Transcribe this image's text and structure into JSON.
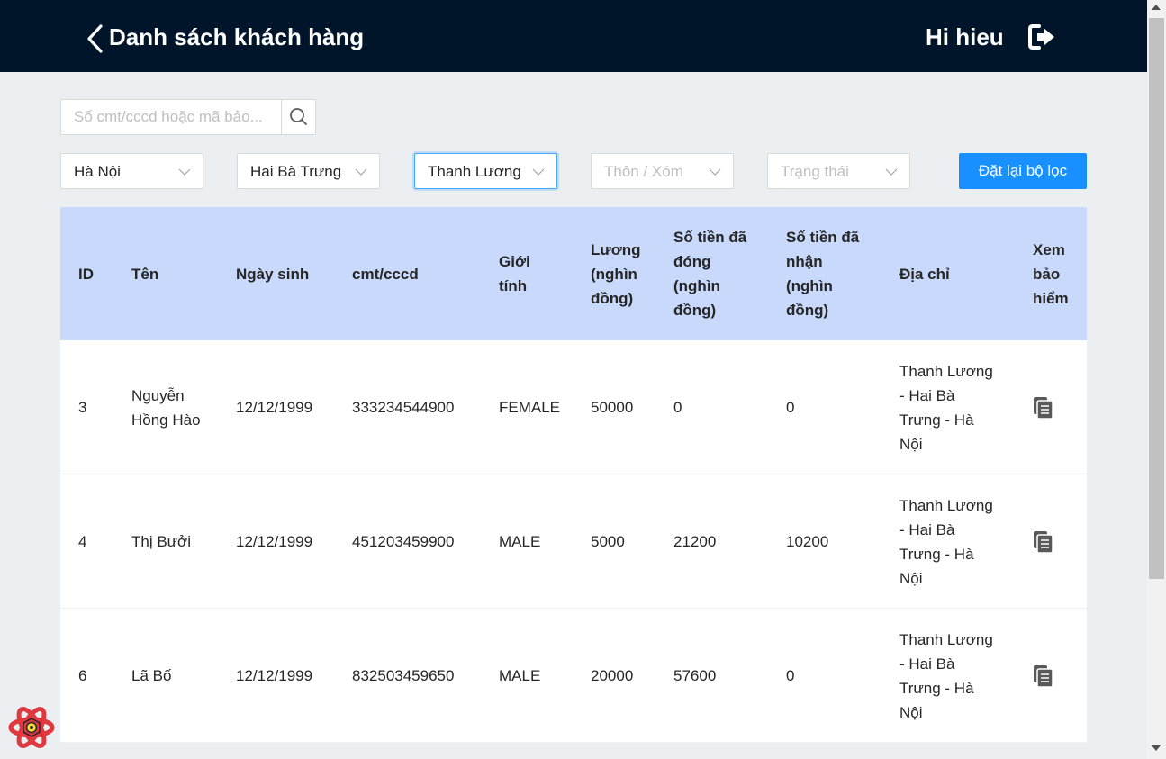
{
  "header": {
    "title": "Danh sách khách hàng",
    "greeting": "Hi hieu"
  },
  "search": {
    "placeholder": "Số cmt/cccd hoặc mã bảo..."
  },
  "filters": {
    "province": "Hà Nội",
    "district": "Hai Bà Trưng",
    "ward": "Thanh Lương",
    "hamlet_placeholder": "Thôn / Xóm",
    "status_placeholder": "Trạng thái"
  },
  "reset_label": "Đặt lại bộ lọc",
  "table": {
    "columns": [
      "ID",
      "Tên",
      "Ngày sinh",
      "cmt/cccd",
      "Giới tính",
      "Lương (nghìn đồng)",
      "Số tiền đã đóng (nghìn đồng)",
      "Số tiền đã nhận (nghìn đồng)",
      "Địa chỉ",
      "Xem bảo hiểm"
    ],
    "rows": [
      {
        "id": "3",
        "name": "Nguyễn Hồng Hào",
        "dob": "12/12/1999",
        "cmt": "333234544900",
        "gender": "FEMALE",
        "salary": "50000",
        "paid": "0",
        "received": "0",
        "address": "Thanh Lương - Hai Bà Trưng - Hà Nội"
      },
      {
        "id": "4",
        "name": "Thị Bưởi",
        "dob": "12/12/1999",
        "cmt": "451203459900",
        "gender": "MALE",
        "salary": "5000",
        "paid": "21200",
        "received": "10200",
        "address": "Thanh Lương - Hai Bà Trưng - Hà Nội"
      },
      {
        "id": "6",
        "name": "Lã Bố",
        "dob": "12/12/1999",
        "cmt": "832503459650",
        "gender": "MALE",
        "salary": "20000",
        "paid": "57600",
        "received": "0",
        "address": "Thanh Lương - Hai Bà Trưng - Hà Nội"
      }
    ]
  },
  "colors": {
    "header_bg": "#001529",
    "primary": "#1890ff",
    "table_head_bg": "#c9d9fb",
    "page_bg": "#eceff1"
  }
}
